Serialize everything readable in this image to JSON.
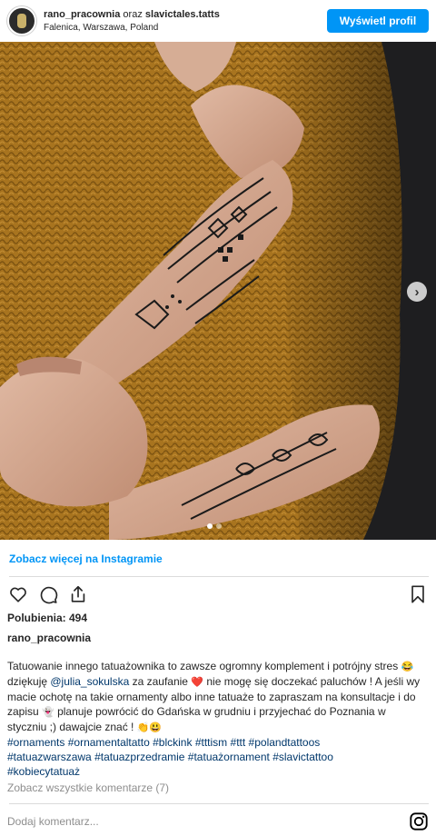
{
  "header": {
    "username": "rano_pracownia",
    "connector": "oraz",
    "coauthor": "slavictales.tatts",
    "location": "Falenica, Warszawa, Poland",
    "view_profile_label": "Wyświetl profil"
  },
  "carousel": {
    "active_index": 0,
    "count": 2
  },
  "more_link": "Zobacz więcej na Instagramie",
  "likes": "Polubienia: 494",
  "poster": "rano_pracownia",
  "caption": {
    "t1": "Tatuowanie innego tatuażownika to zawsze ogromny komplement i potrójny stres ",
    "e1": "😂",
    "t2": " dziękuję ",
    "mention": "@julia_sokulska",
    "t3": " za zaufanie ",
    "e2": "❤️",
    "t4": " nie mogę się doczekać paluchów ! A jeśli wy macie ochotę na takie ornamenty albo inne tatuaże to zapraszam na konsultacje i do zapisu ",
    "e3": "👻",
    "t5": " planuje powrócić do Gdańska w grudniu i przyjechać do Poznania w styczniu ;) dawajcie znać ! ",
    "e4": "👏😃",
    "hashtags": [
      "#ornaments",
      "#ornamentaltatto",
      "#blckink",
      "#tttism",
      "#ttt",
      "#polandtattoos",
      "#tatuazwarszawa",
      "#tatuazprzedramie",
      "#tatuażornament",
      "#slavictattoo",
      "#kobiecytatuaż"
    ]
  },
  "comments_link": "Zobacz wszystkie komentarze (7)",
  "add_comment_placeholder": "Dodaj komentarz...",
  "icons": {
    "like": "heart-outline-icon",
    "comment": "comment-bubble-icon",
    "share": "share-upload-icon",
    "save": "bookmark-icon",
    "next": "chevron-right-icon",
    "brand": "instagram-icon"
  },
  "colors": {
    "accent": "#0095f6",
    "link": "#00376b",
    "muted": "#8e8e8e",
    "sweater": "#a8741f"
  }
}
